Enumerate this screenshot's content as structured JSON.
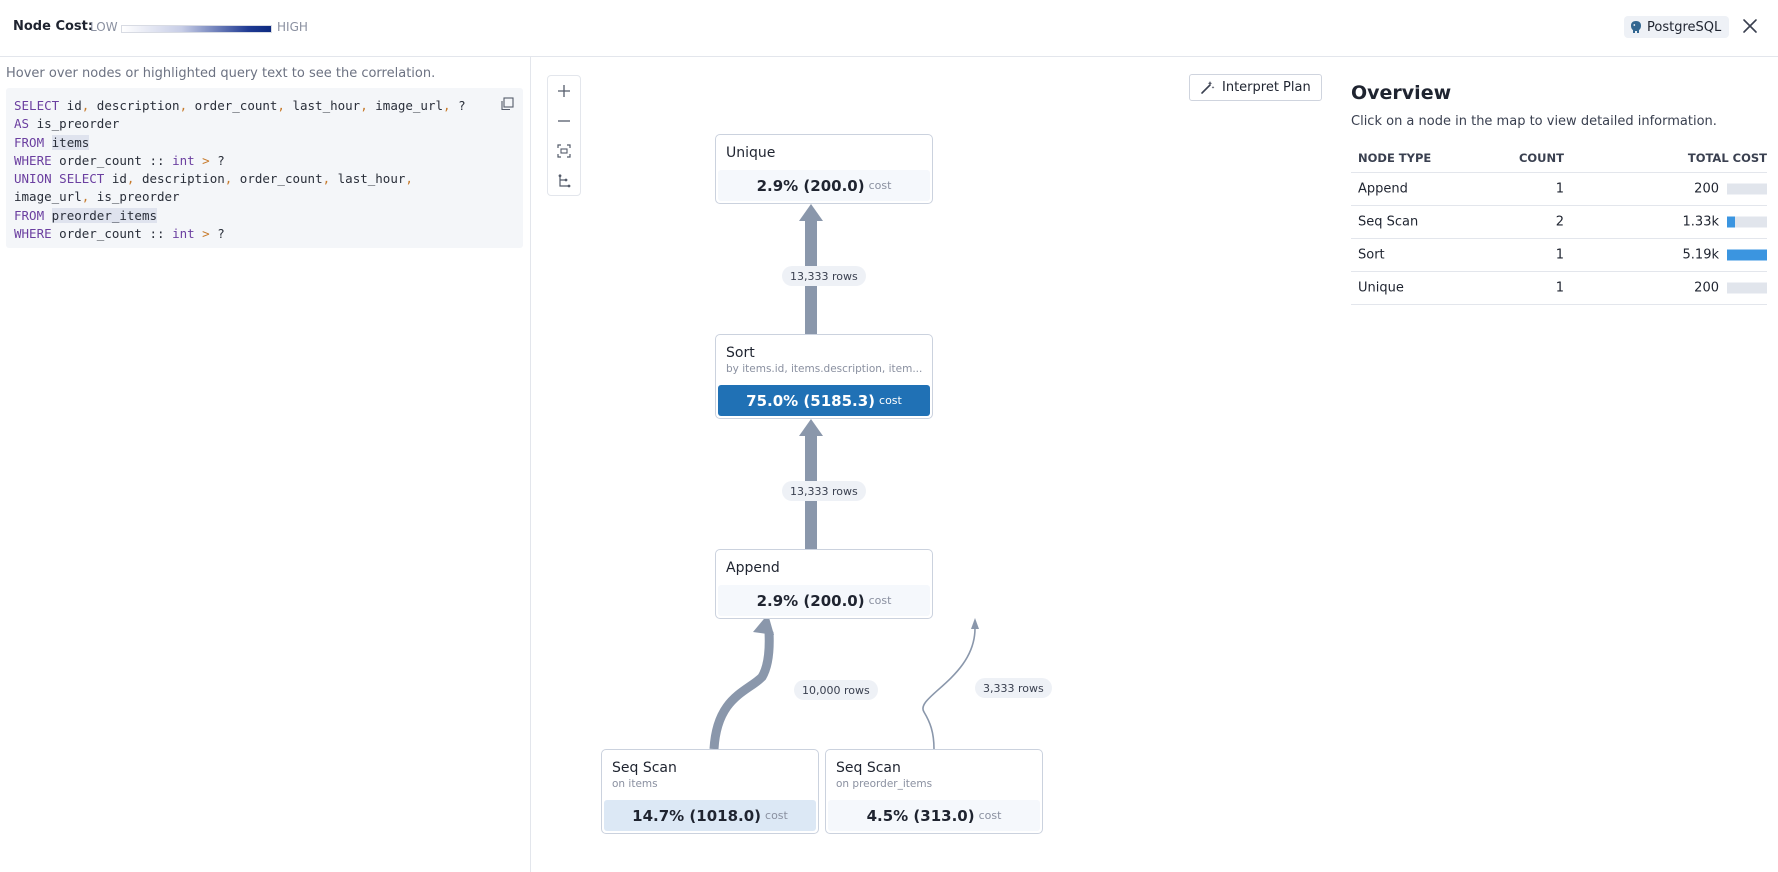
{
  "header": {
    "node_cost_label": "Node Cost:",
    "low_label": "LOW",
    "high_label": "HIGH",
    "database": "PostgreSQL"
  },
  "query_panel": {
    "hint": "Hover over nodes or highlighted query text to see the correlation.",
    "lines": [
      "SELECT id, description, order_count, last_hour, image_url, ?",
      "AS is_preorder",
      "FROM items",
      "WHERE order_count :: int > ?",
      "UNION SELECT id, description, order_count, last_hour,",
      "image_url, is_preorder",
      "FROM preorder_items",
      "WHERE order_count :: int > ?"
    ]
  },
  "map": {
    "interpret_button": "Interpret Plan",
    "cost_unit": "cost",
    "nodes": {
      "unique": {
        "title": "Unique",
        "subtitle": "",
        "cost": "2.9% (200.0)"
      },
      "sort": {
        "title": "Sort",
        "subtitle": "by items.id, items.description, item...",
        "cost": "75.0% (5185.3)"
      },
      "append": {
        "title": "Append",
        "subtitle": "",
        "cost": "2.9% (200.0)"
      },
      "seq_scan_items": {
        "title": "Seq Scan",
        "subtitle": "on items",
        "cost": "14.7% (1018.0)"
      },
      "seq_scan_preorder": {
        "title": "Seq Scan",
        "subtitle": "on preorder_items",
        "cost": "4.5% (313.0)"
      }
    },
    "edges": {
      "sort_to_unique": "13,333 rows",
      "append_to_sort": "13,333 rows",
      "items_to_append": "10,000 rows",
      "preorder_to_append": "3,333 rows"
    }
  },
  "overview": {
    "title": "Overview",
    "description": "Click on a node in the map to view detailed information.",
    "columns": [
      "NODE TYPE",
      "COUNT",
      "TOTAL COST"
    ],
    "rows": [
      {
        "type": "Append",
        "count": "1",
        "total_cost": "200",
        "cost_fraction": 0.0
      },
      {
        "type": "Seq Scan",
        "count": "2",
        "total_cost": "1.33k",
        "cost_fraction": 0.2
      },
      {
        "type": "Sort",
        "count": "1",
        "total_cost": "5.19k",
        "cost_fraction": 1.0
      },
      {
        "type": "Unique",
        "count": "1",
        "total_cost": "200",
        "cost_fraction": 0.0
      }
    ]
  },
  "colors": {
    "hot_cost": "#2071b5",
    "warm_cost": "#dce8f5",
    "bar_fill": "#3b95e0",
    "edge": "#8a97ab"
  }
}
